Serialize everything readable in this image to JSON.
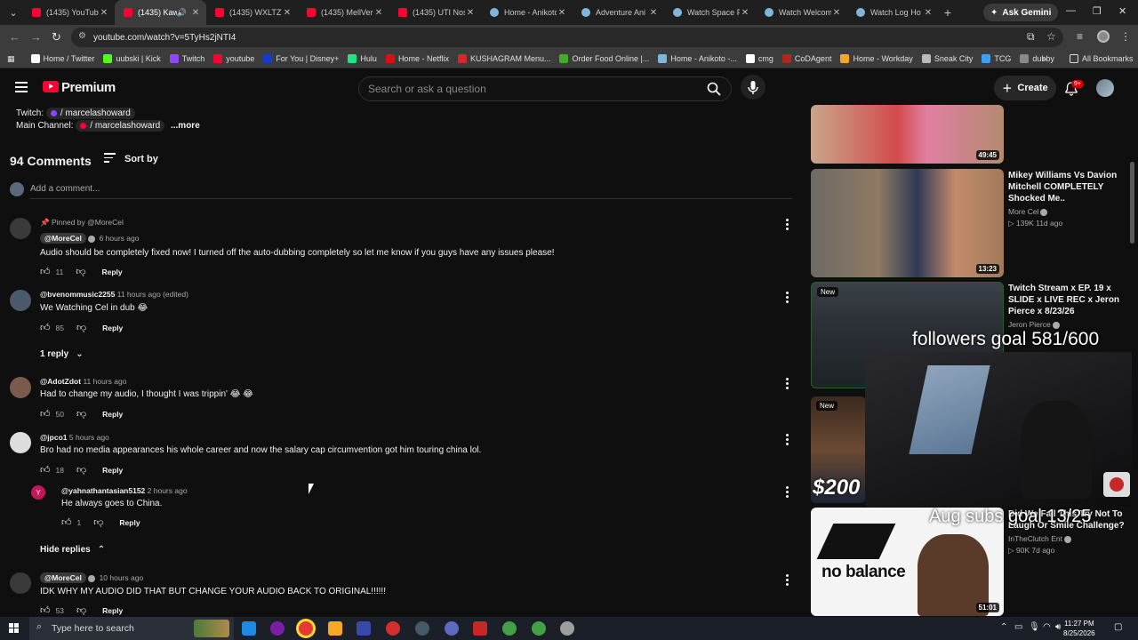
{
  "browser": {
    "tabs": [
      {
        "title": "(1435) YouTube",
        "icon": "youtube-icon",
        "active": false
      },
      {
        "title": "(1435) Kawi",
        "icon": "youtube-icon",
        "active": true
      },
      {
        "title": "(1435) WXLTZY",
        "icon": "youtube-icon",
        "active": false
      },
      {
        "title": "(1435) MellVer",
        "icon": "youtube-icon",
        "active": false
      },
      {
        "title": "(1435) UTI Nos",
        "icon": "youtube-icon",
        "active": false
      },
      {
        "title": "Home - Anikoto",
        "icon": "globe-icon",
        "active": false
      },
      {
        "title": "Adventure Ani",
        "icon": "globe-icon",
        "active": false
      },
      {
        "title": "Watch Space P",
        "icon": "globe-icon",
        "active": false
      },
      {
        "title": "Watch Welcom",
        "icon": "globe-icon",
        "active": false
      },
      {
        "title": "Watch Log Ho",
        "icon": "globe-icon",
        "active": false
      }
    ],
    "ask_gemini": "Ask Gemini",
    "url": "youtube.com/watch?v=5TyHs2jNTI4",
    "bookmarks": [
      {
        "label": "Home / Twitter",
        "color": "#ffffff"
      },
      {
        "label": "uubski | Kick",
        "color": "#53fc18"
      },
      {
        "label": "Twitch",
        "color": "#9146ff"
      },
      {
        "label": "youtube",
        "color": "#ff0033"
      },
      {
        "label": "For You | Disney+",
        "color": "#113ccf"
      },
      {
        "label": "Hulu",
        "color": "#1ce783"
      },
      {
        "label": "Home - Netflix",
        "color": "#e50914"
      },
      {
        "label": "KUSHAGRAM Menu...",
        "color": "#d62828"
      },
      {
        "label": "Order Food Online |...",
        "color": "#3fae29"
      },
      {
        "label": "Home - Anikoto -...",
        "color": "#7fb6d9"
      },
      {
        "label": "cmg",
        "color": "#ffffff"
      },
      {
        "label": "CoDAgent",
        "color": "#b3261e"
      },
      {
        "label": "Home - Workday",
        "color": "#f5a623"
      },
      {
        "label": "Sneak City",
        "color": "#bbbbbb"
      },
      {
        "label": "TCG",
        "color": "#3aa0ff"
      },
      {
        "label": "dubby",
        "color": "#888888"
      }
    ],
    "all_bookmarks": "All Bookmarks"
  },
  "youtube": {
    "logo_text": "Premium",
    "search_placeholder": "Search or ask a question",
    "create_label": "Create",
    "notif_badge": "9+",
    "description": {
      "twitch_label": "Twitch:",
      "twitch_handle": "/ marcelashoward",
      "main_label": "Main Channel:",
      "main_handle": "/ marcelashoward",
      "more": "...more"
    },
    "comments_count": "94 Comments",
    "sort_by": "Sort by",
    "add_comment_placeholder": "Add a comment...",
    "comments": [
      {
        "pinned_text": "Pinned by @MoreCel",
        "author": "@MoreCel",
        "owner": true,
        "time": "6 hours ago",
        "text": "Audio should be completely fixed now! I turned off the auto-dubbing completely so let me know if you guys have any issues please!",
        "likes": "11",
        "reply": "Reply",
        "avatar_color": "#3a3a3a"
      },
      {
        "author": "@bvenommusic2255",
        "owner": false,
        "time": "11 hours ago (edited)",
        "text": "We Watching Cel in dub 😂",
        "likes": "85",
        "reply": "Reply",
        "avatar_color": "#4a5a6a"
      },
      {
        "author": "@AdotZdot",
        "owner": false,
        "time": "11 hours ago",
        "text": "Had to change my audio, I thought I was trippin' 😂 😂",
        "likes": "50",
        "reply": "Reply",
        "avatar_color": "#7a5a4a"
      },
      {
        "author": "@jpco1",
        "owner": false,
        "time": "5 hours ago",
        "text": "Bro had no media appearances his whole career and now the salary cap circumvention got him touring china lol.",
        "likes": "18",
        "reply": "Reply",
        "avatar_color": "#dddddd"
      },
      {
        "author": "@yahnathantasian5152",
        "owner": false,
        "time": "2 hours ago",
        "text": "He always goes to China.",
        "likes": "1",
        "reply": "Reply",
        "avatar_letter": "Y",
        "avatar_color": "#c2185b"
      },
      {
        "author": "@MoreCel",
        "owner": true,
        "time": "10 hours ago",
        "text": "IDK WHY MY AUDIO DID THAT BUT CHANGE YOUR AUDIO BACK TO ORIGINAL!!!!!!",
        "likes": "53",
        "reply": "Reply",
        "avatar_color": "#3a3a3a"
      }
    ],
    "one_reply": "1 reply",
    "hide_replies": "Hide replies",
    "recommended": [
      {
        "title": "",
        "channel": "",
        "meta": "",
        "duration": "49:45"
      },
      {
        "title": "Mikey Williams Vs Davion Mitchell COMPLETELY Shocked Me..",
        "channel": "More Cel",
        "meta": "▷ 139K   11d ago",
        "duration": "13:23"
      },
      {
        "title": "Twitch Stream x EP. 19 x SLIDE x LIVE REC x Jeron Pierce x 8/23/26",
        "channel": "Jeron Pierce",
        "meta": "",
        "badge": "New"
      },
      {
        "title": "",
        "channel": "",
        "meta": "",
        "badge": "New"
      },
      {
        "title": "Did We Fall This Try Not To Laugh Or Smile Challenge?",
        "channel": "InTheClutch Ent",
        "meta": "▷ 90K   7d ago",
        "duration": "51:01"
      }
    ],
    "overlay_followers": "followers goal 581/600",
    "overlay_aug": "Aug subs goal 13/25",
    "thumb_text_200": "$200",
    "thumb_text_nb": "no balance"
  },
  "taskbar": {
    "search_placeholder": "Type here to search",
    "time": "11:27 PM",
    "date": "8/25/2026"
  }
}
